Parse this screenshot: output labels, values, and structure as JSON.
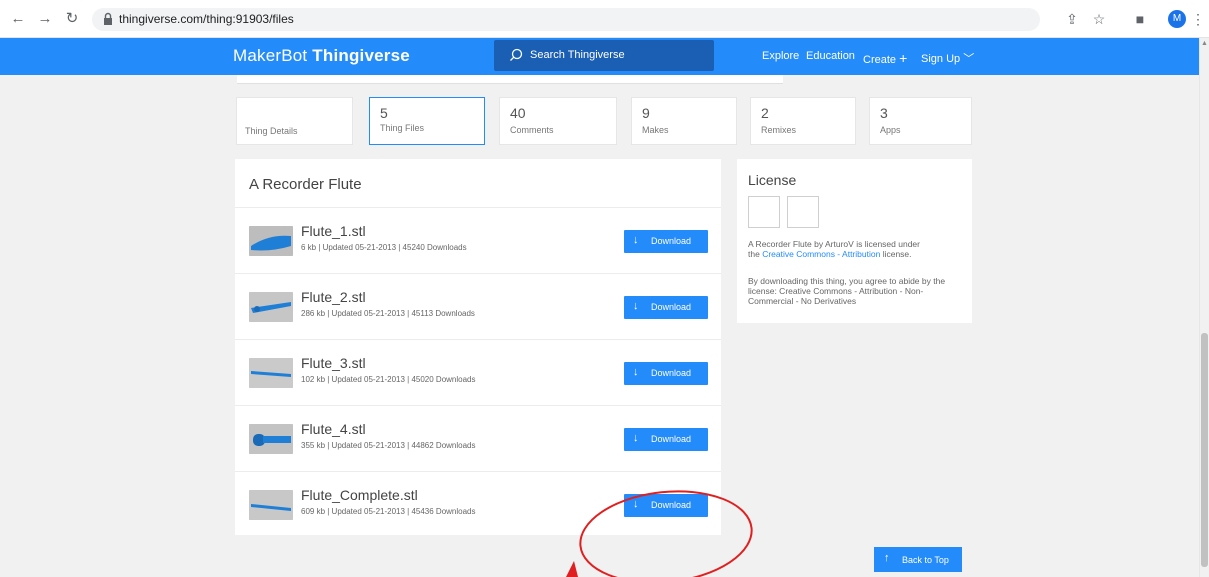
{
  "browser": {
    "url": "thingiverse.com/thing:91903/files",
    "avatar_initial": "M"
  },
  "header": {
    "logo_a": "MakerBot",
    "logo_b": "Thingiverse",
    "search_placeholder": "Search Thingiverse",
    "nav": {
      "explore": "Explore",
      "education": "Education",
      "create": "Create",
      "signup": "Sign Up"
    }
  },
  "tabs": [
    {
      "count": "",
      "label": "Thing Details"
    },
    {
      "count": "5",
      "label": "Thing Files"
    },
    {
      "count": "40",
      "label": "Comments"
    },
    {
      "count": "9",
      "label": "Makes"
    },
    {
      "count": "2",
      "label": "Remixes"
    },
    {
      "count": "3",
      "label": "Apps"
    }
  ],
  "files": {
    "title": "A Recorder Flute",
    "download_label": "Download",
    "items": [
      {
        "name": "Flute_1.stl",
        "meta": "6 kb | Updated 05-21-2013 | 45240 Downloads"
      },
      {
        "name": "Flute_2.stl",
        "meta": "286 kb | Updated 05-21-2013 | 45113 Downloads"
      },
      {
        "name": "Flute_3.stl",
        "meta": "102 kb | Updated 05-21-2013 | 45020 Downloads"
      },
      {
        "name": "Flute_4.stl",
        "meta": "355 kb | Updated 05-21-2013 | 44862 Downloads"
      },
      {
        "name": "Flute_Complete.stl",
        "meta": "609 kb | Updated 05-21-2013 | 45436 Downloads"
      }
    ]
  },
  "license": {
    "title": "License",
    "line1a": "A Recorder Flute by ArturoV is licensed under",
    "line1b": "the",
    "link": "Creative Commons - Attribution",
    "line1c": "license.",
    "agree": "By downloading this thing, you agree to abide by the license: Creative Commons - Attribution - Non-Commercial - No Derivatives"
  },
  "back_to_top": "Back to Top",
  "colors": {
    "brand_blue": "#248bfb",
    "annotation_red": "#e02020"
  }
}
